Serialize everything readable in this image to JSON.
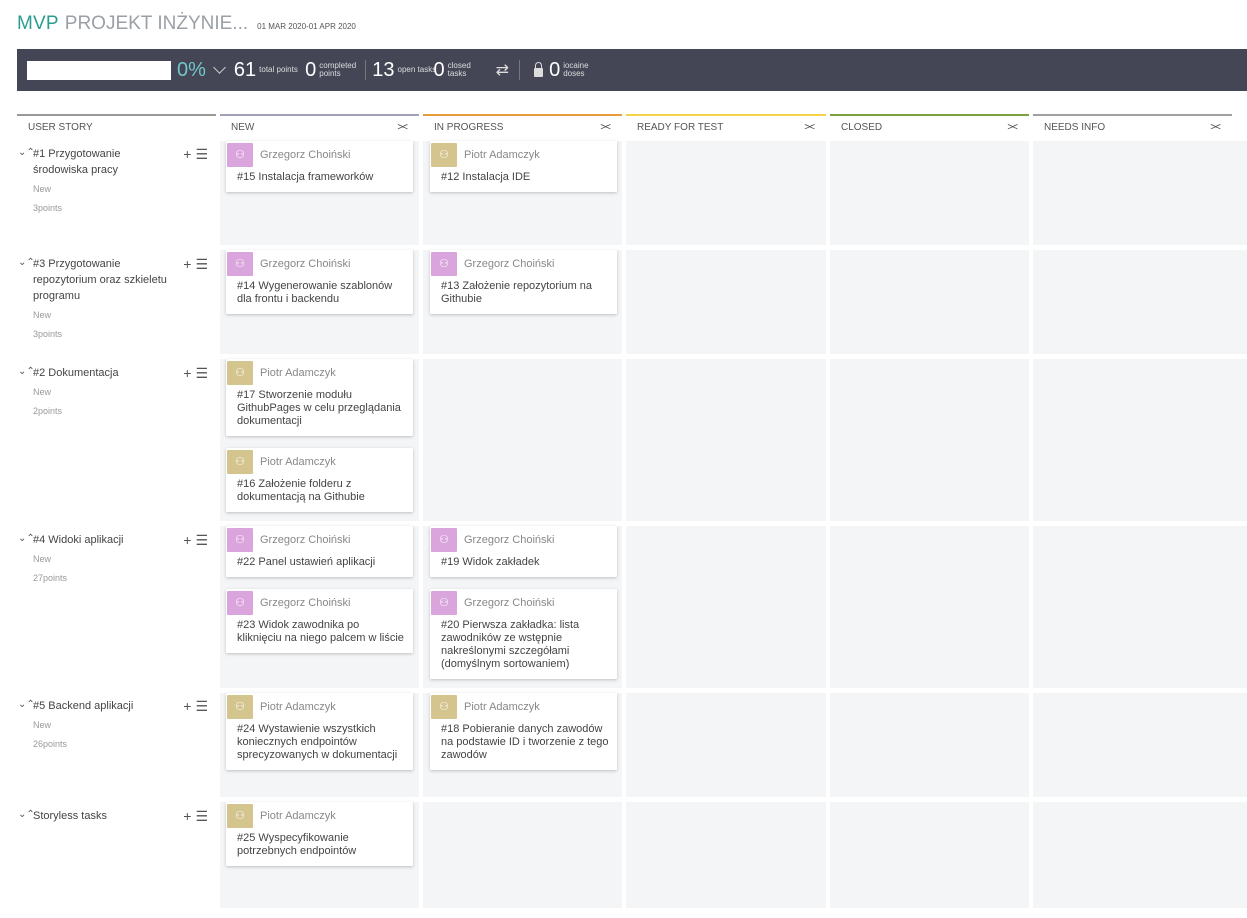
{
  "header": {
    "project_prefix": "MVP",
    "project_name": "PROJEKT INŻYNIE...",
    "dates": "01 MAR 2020-01 APR 2020"
  },
  "stats": {
    "progress_percent": "0%",
    "progress_value": 0,
    "total_points": "61",
    "total_points_label": "total points",
    "completed_points": "0",
    "completed_points_label": "completed points",
    "open_tasks": "13",
    "open_tasks_label": "open tasks",
    "closed_tasks": "0",
    "closed_tasks_label": "closed tasks",
    "iocaine": "0",
    "iocaine_label": "iocaine doses"
  },
  "columns": [
    {
      "label": "USER STORY",
      "color": "#999999"
    },
    {
      "label": "NEW",
      "color": "#a0a0b8"
    },
    {
      "label": "IN PROGRESS",
      "color": "#e89c3c"
    },
    {
      "label": "READY FOR TEST",
      "color": "#f5d24a"
    },
    {
      "label": "CLOSED",
      "color": "#7ba23f"
    },
    {
      "label": "NEEDS INFO",
      "color": "#a0a0a0"
    }
  ],
  "fold_glyph": "><",
  "stories": [
    {
      "title": "#1 Przygotowanie środowiska pracy",
      "status": "New",
      "points": "3points"
    },
    {
      "title": "#3 Przygotowanie repozytorium oraz szkieletu programu",
      "status": "New",
      "points": "3points"
    },
    {
      "title": "#2 Dokumentacja",
      "status": "New",
      "points": "2points"
    },
    {
      "title": "#4 Widoki aplikacji",
      "status": "New",
      "points": "27points"
    },
    {
      "title": "#5 Backend aplikacji",
      "status": "New",
      "points": "26points"
    },
    {
      "title": "Storyless tasks",
      "status": "",
      "points": ""
    }
  ],
  "cards": [
    {
      "user": "Grzegorz Choiński",
      "text": "#15 Instalacja frameworków",
      "avatar": "pink"
    },
    {
      "user": "Piotr Adamczyk",
      "text": "#12 Instalacja IDE",
      "avatar": "gold"
    },
    {
      "user": "Grzegorz Choiński",
      "text": "#14 Wygenerowanie szablonów dla frontu i backendu",
      "avatar": "pink"
    },
    {
      "user": "Grzegorz Choiński",
      "text": "#13 Założenie repozytorium na Githubie",
      "avatar": "pink"
    },
    {
      "user": "Piotr Adamczyk",
      "text": "#17 Stworzenie modułu GithubPages w celu przeglądania dokumentacji",
      "avatar": "gold"
    },
    {
      "user": "Piotr Adamczyk",
      "text": "#16 Założenie folderu z dokumentacją na Githubie",
      "avatar": "gold"
    },
    {
      "user": "Grzegorz Choiński",
      "text": "#22 Panel ustawień aplikacji",
      "avatar": "pink"
    },
    {
      "user": "Grzegorz Choiński",
      "text": "#19 Widok zakładek",
      "avatar": "pink"
    },
    {
      "user": "Grzegorz Choiński",
      "text": "#23 Widok zawodnika po kliknięciu na niego palcem w liście",
      "avatar": "pink"
    },
    {
      "user": "Grzegorz Choiński",
      "text": "#20 Pierwsza zakładka: lista zawodników ze wstępnie nakreślonymi szczegółami (domyślnym sortowaniem)",
      "avatar": "pink"
    },
    {
      "user": "Piotr Adamczyk",
      "text": "#24 Wystawienie wszystkich koniecznych endpointów sprecyzowanych w dokumentacji",
      "avatar": "gold"
    },
    {
      "user": "Piotr Adamczyk",
      "text": "#18 Pobieranie danych zawodów na podstawie ID i tworzenie z tego zawodów",
      "avatar": "gold"
    },
    {
      "user": "Piotr Adamczyk",
      "text": "#25 Wyspecyfikowanie potrzebnych endpointów",
      "avatar": "gold"
    }
  ],
  "colors": {
    "accent_teal": "#2a9d8f",
    "statsbar_bg": "#444656",
    "avatar_pink": "#d9a5dc",
    "avatar_gold": "#d4c48d",
    "lane_bg": "#f4f5f7"
  }
}
